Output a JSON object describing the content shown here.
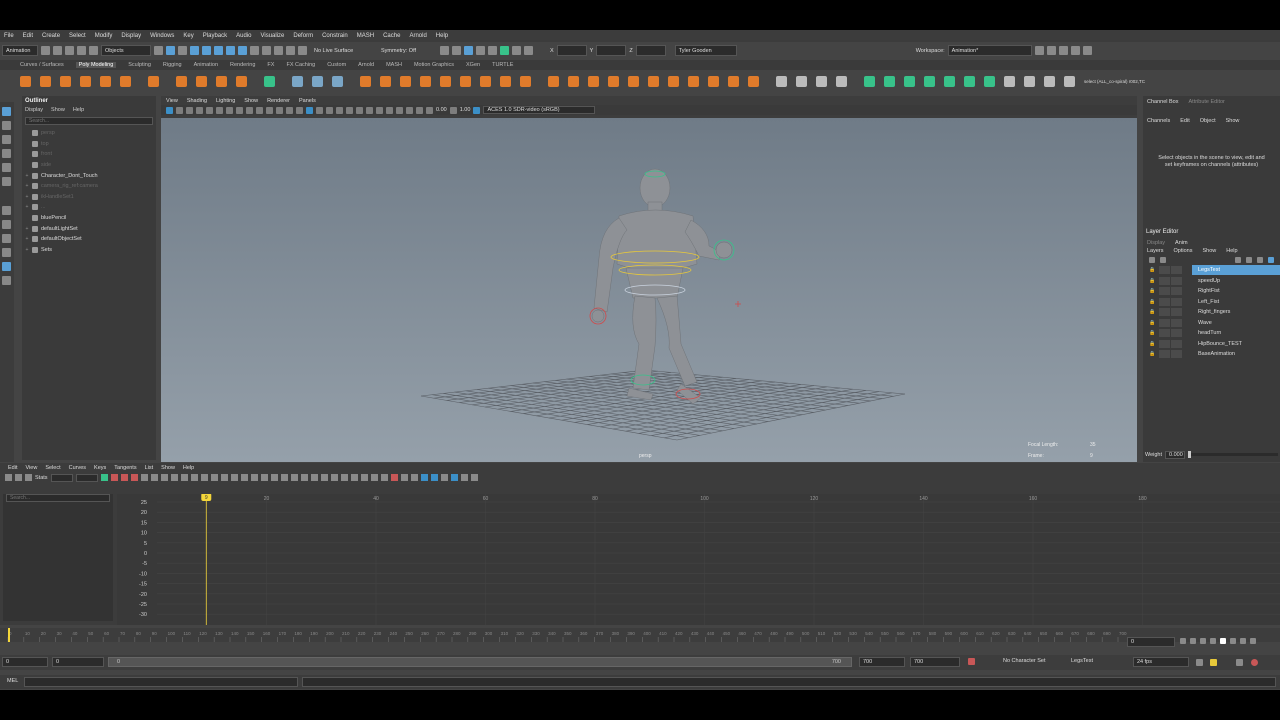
{
  "menubar": [
    "File",
    "Edit",
    "Create",
    "Select",
    "Modify",
    "Display",
    "Windows",
    "Key",
    "Playback",
    "Audio",
    "Visualize",
    "Deform",
    "Constrain",
    "MASH",
    "Cache",
    "Arnold",
    "Help"
  ],
  "status": {
    "menuset": "Animation",
    "objects_label": "Objects",
    "live_surface": "No Live Surface",
    "symmetry": "Symmetry: Off",
    "user": "Tyler Gooden",
    "workspace_label": "Workspace:",
    "workspace": "Animation*"
  },
  "shelf_tabs": [
    "Curves / Surfaces",
    "Poly Modeling",
    "Sculpting",
    "Rigging",
    "Animation",
    "Rendering",
    "FX",
    "FX Caching",
    "Custom",
    "Arnold",
    "MASH",
    "Motion Graphics",
    "XGen",
    "TURTLE"
  ],
  "shelf_active": "Poly Modeling",
  "shelf_end_label": "select (ALL_co-spiral) r002,TC",
  "outliner": {
    "title": "Outliner",
    "menu": [
      "Display",
      "Show",
      "Help"
    ],
    "search_placeholder": "Search...",
    "items": [
      {
        "label": "persp",
        "dim": true,
        "exp": ""
      },
      {
        "label": "top",
        "dim": true,
        "exp": ""
      },
      {
        "label": "front",
        "dim": true,
        "exp": ""
      },
      {
        "label": "side",
        "dim": true,
        "exp": ""
      },
      {
        "label": "Character_Dont_Touch",
        "dim": false,
        "exp": "+"
      },
      {
        "label": "camera_rig_ref:camera",
        "dim": true,
        "exp": "+"
      },
      {
        "label": "ikHandleSet1",
        "dim": true,
        "exp": "+"
      },
      {
        "label": "...",
        "dim": true,
        "exp": "+"
      },
      {
        "label": "bluePencil",
        "dim": false,
        "exp": ""
      },
      {
        "label": "defaultLightSet",
        "dim": false,
        "exp": "+"
      },
      {
        "label": "defaultObjectSet",
        "dim": false,
        "exp": "+"
      },
      {
        "label": "Sets",
        "dim": false,
        "exp": "+"
      }
    ]
  },
  "viewport": {
    "menu": [
      "View",
      "Shading",
      "Lighting",
      "Show",
      "Renderer",
      "Panels"
    ],
    "exposure": "0.00",
    "gamma": "1.00",
    "color_space": "ACES 1.0 SDR-video (sRGB)",
    "camera_label": "persp",
    "focal_length_label": "Focal Length:",
    "focal_length": "35",
    "frame_label": "Frame:",
    "frame": "9"
  },
  "channel_box": {
    "tabs": [
      "Channel Box",
      "Attribute Editor"
    ],
    "menu": [
      "Channels",
      "Edit",
      "Object",
      "Show"
    ],
    "hint": "Select objects in the scene to view, edit and set keyframes on channels (attributes)"
  },
  "layer_editor": {
    "title": "Layer Editor",
    "tabs": [
      "Display",
      "Anim"
    ],
    "menu": [
      "Layers",
      "Options",
      "Show",
      "Help"
    ],
    "layers": [
      {
        "name": "LegsTest",
        "selected": true
      },
      {
        "name": "speedUp",
        "selected": false
      },
      {
        "name": "RightFist",
        "selected": false
      },
      {
        "name": "Left_Fist",
        "selected": false
      },
      {
        "name": "Right_fingers",
        "selected": false
      },
      {
        "name": "Wave",
        "selected": false
      },
      {
        "name": "headTurn",
        "selected": false
      },
      {
        "name": "HipBounce_TEST",
        "selected": false
      },
      {
        "name": "BaseAnimation",
        "selected": false
      }
    ],
    "weight_label": "Weight",
    "weight_value": "0.000"
  },
  "graph_editor": {
    "menu": [
      "Edit",
      "View",
      "Select",
      "Curves",
      "Keys",
      "Tangents",
      "List",
      "Show",
      "Help"
    ],
    "stats_label": "Stats",
    "search_placeholder": "Search...",
    "current_frame": "9",
    "frame_ticks": [
      "20",
      "40",
      "60",
      "80",
      "100",
      "120",
      "140",
      "160",
      "180"
    ],
    "value_ticks": [
      "25",
      "20",
      "15",
      "10",
      "5",
      "0",
      "-5",
      "-10",
      "-15",
      "-20",
      "-25",
      "-30"
    ]
  },
  "time_slider": {
    "current_frame": "0",
    "ticks": [
      "0",
      "10",
      "20",
      "30",
      "40",
      "50",
      "60",
      "70",
      "80",
      "90",
      "100",
      "110",
      "120",
      "130",
      "140",
      "150",
      "160",
      "170",
      "180",
      "190",
      "200",
      "210",
      "220",
      "230",
      "240",
      "250",
      "260",
      "270",
      "280",
      "290",
      "300",
      "310",
      "320",
      "330",
      "340",
      "350",
      "360",
      "370",
      "380",
      "390",
      "400",
      "410",
      "420",
      "430",
      "440",
      "450",
      "460",
      "470",
      "480",
      "490",
      "500",
      "510",
      "520",
      "530",
      "540",
      "550",
      "560",
      "570",
      "580",
      "590",
      "600",
      "610",
      "620",
      "630",
      "640",
      "650",
      "660",
      "670",
      "680",
      "690",
      "700"
    ]
  },
  "range": {
    "start": "0",
    "anim_start": "0",
    "range_min": "0",
    "range_max": "700",
    "end": "700",
    "anim_end": "700",
    "character_set": "No Character Set",
    "anim_layer": "LegsTest",
    "fps": "24 fps"
  },
  "mel_label": "MEL",
  "colors": {
    "accent": "#5aa0d6",
    "playhead": "#f4d63a",
    "viewport_top": "#6f7b87",
    "viewport_bottom": "#95a0aa"
  }
}
